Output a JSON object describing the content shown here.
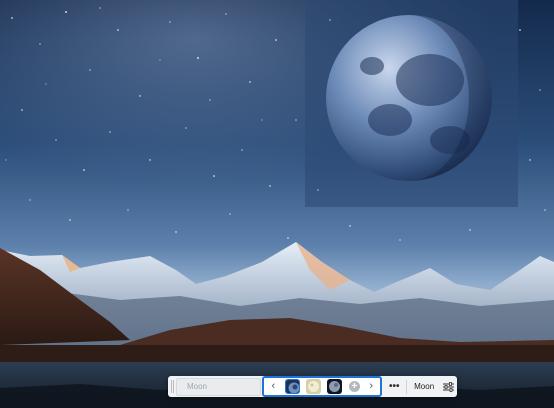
{
  "toolbar": {
    "name_field_placeholder": "Moon",
    "moon_label": "Moon",
    "prev_icon": "chevron-left-icon",
    "next_icon": "chevron-right-icon",
    "more_icon": "more-horizontal-icon",
    "settings_icon": "sliders-icon",
    "add_icon": "plus-circle-icon",
    "thumbnails": [
      {
        "name": "earth-moon-thumbnail",
        "selected": true
      },
      {
        "name": "full-moon-thumbnail",
        "selected": false
      },
      {
        "name": "dark-moon-thumbnail",
        "selected": false
      }
    ],
    "accent_color": "#1f74d6"
  }
}
